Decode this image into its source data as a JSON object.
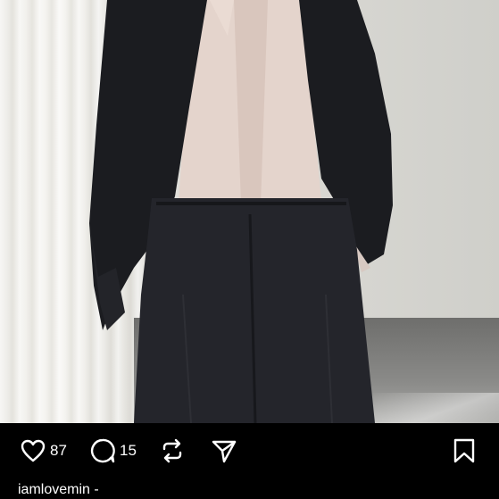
{
  "post": {
    "image_alt": "Person in black suit jacket and trousers with blush satin shirt, hands in pockets, beside a sheer curtain"
  },
  "actions": {
    "like": {
      "icon": "heart-icon",
      "count": "87"
    },
    "comment": {
      "icon": "comment-bubble-icon",
      "count": "15"
    },
    "repost": {
      "icon": "repost-icon"
    },
    "share": {
      "icon": "send-icon"
    },
    "save": {
      "icon": "bookmark-icon"
    }
  },
  "caption": {
    "username": "iamlovemin",
    "text": " -"
  },
  "colors": {
    "background": "#000000",
    "icon": "#ffffff",
    "text": "#ffffff"
  }
}
